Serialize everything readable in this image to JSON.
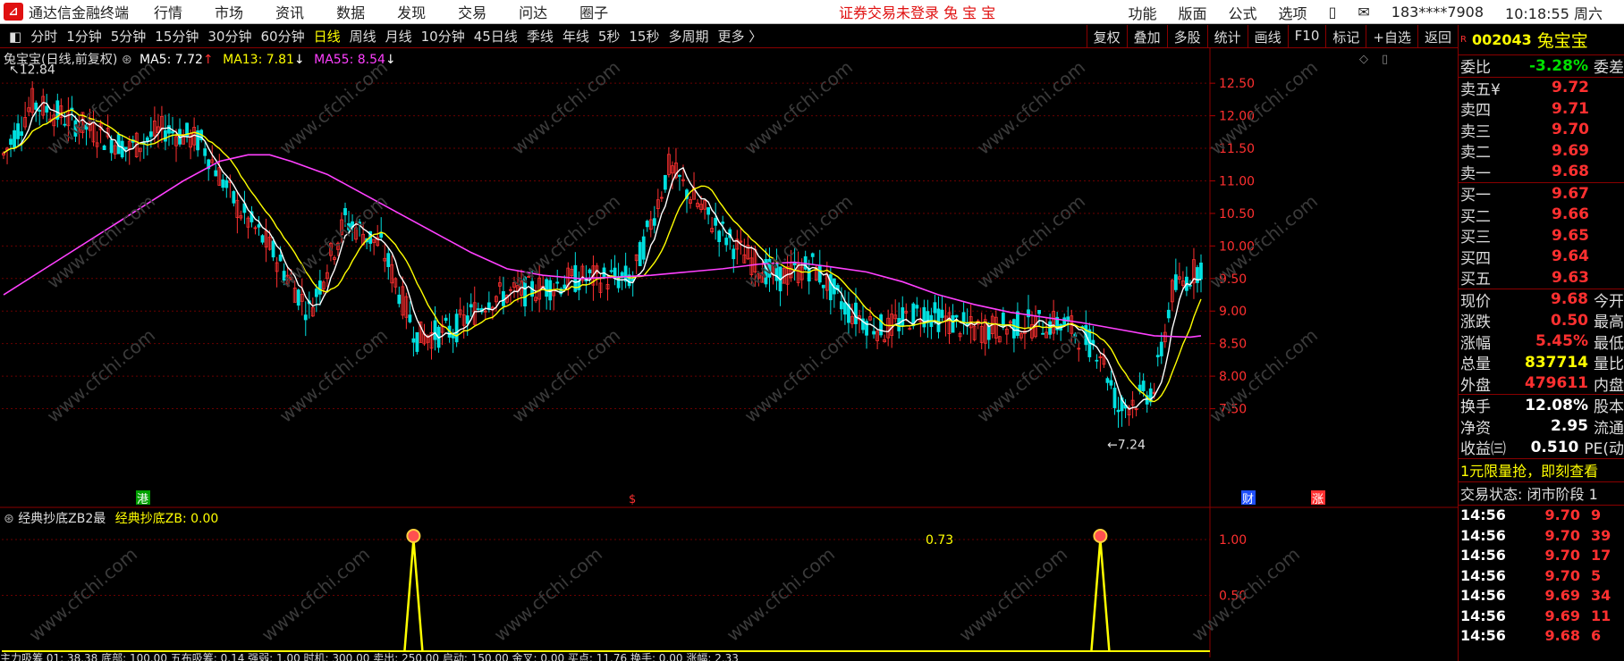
{
  "menubar": {
    "app_name": "通达信金融终端",
    "items": [
      "行情",
      "市场",
      "资讯",
      "数据",
      "发现",
      "交易",
      "问达",
      "圈子"
    ],
    "warning": "证券交易未登录  兔 宝 宝",
    "right_items": [
      "功能",
      "版面",
      "公式",
      "选项"
    ],
    "user": "183****7908",
    "clock": "10:18:55 周六"
  },
  "toolbar": {
    "periods": [
      "分时",
      "1分钟",
      "5分钟",
      "15分钟",
      "30分钟",
      "60分钟",
      "日线",
      "周线",
      "月线",
      "10分钟",
      "45日线",
      "季线",
      "年线",
      "5秒",
      "15秒",
      "多周期",
      "更多 〉"
    ],
    "active": "日线",
    "tools": [
      "复权",
      "叠加",
      "多股",
      "统计",
      "画线",
      "F10",
      "标记",
      "+自选",
      "返回"
    ]
  },
  "main_chart": {
    "title": "兔宝宝(日线,前复权)",
    "ma5": "MA5: 7.72",
    "ma13": "MA13: 7.81",
    "ma55": "MA55: 8.54",
    "high_label": "12.84",
    "low_label": "7.24",
    "markers": [
      "港",
      "$",
      "财",
      "涨"
    ],
    "watermark": "www.cfchi.com"
  },
  "sub_chart": {
    "title": "经典抄底ZB2最",
    "value_label": "经典抄底ZB: 0.00",
    "peak_value": "0.73",
    "yticks": [
      "1.00",
      "0.50"
    ]
  },
  "bottom_strip": "主力吸筹 01: 38.38   底部: 100.00   五布吸筹: 0.14   强弱: 1.00   时机: 300.00   卖出: 250.00   启动: 150.00   金叉: 0.00   买点: 11.76   换手: 0.00   涨幅: 2.33",
  "chart_data": {
    "type": "candlestick",
    "title": "兔宝宝(日线,前复权)",
    "ylim": [
      7.0,
      12.9
    ],
    "yticks": [
      12.5,
      12.0,
      11.5,
      11.0,
      10.5,
      10.0,
      9.5,
      9.0,
      8.5,
      8.0,
      7.5
    ],
    "series_names": [
      "MA5",
      "MA13",
      "MA55"
    ],
    "extremes": {
      "high": 12.84,
      "low": 7.24
    },
    "ma55": [
      [
        0,
        9.25
      ],
      [
        10,
        9.6
      ],
      [
        20,
        9.95
      ],
      [
        30,
        10.3
      ],
      [
        40,
        10.65
      ],
      [
        50,
        11.0
      ],
      [
        60,
        11.3
      ],
      [
        68,
        11.4
      ],
      [
        74,
        11.4
      ],
      [
        80,
        11.3
      ],
      [
        90,
        11.1
      ],
      [
        100,
        10.8
      ],
      [
        110,
        10.5
      ],
      [
        120,
        10.2
      ],
      [
        130,
        9.9
      ],
      [
        140,
        9.65
      ],
      [
        150,
        9.55
      ],
      [
        160,
        9.5
      ],
      [
        170,
        9.52
      ],
      [
        180,
        9.55
      ],
      [
        190,
        9.6
      ],
      [
        200,
        9.65
      ],
      [
        210,
        9.72
      ],
      [
        220,
        9.75
      ],
      [
        230,
        9.68
      ],
      [
        240,
        9.6
      ],
      [
        250,
        9.45
      ],
      [
        260,
        9.25
      ],
      [
        270,
        9.1
      ],
      [
        280,
        8.98
      ],
      [
        290,
        8.9
      ],
      [
        300,
        8.82
      ],
      [
        310,
        8.72
      ],
      [
        320,
        8.62
      ],
      [
        330,
        8.6
      ],
      [
        333,
        8.62
      ]
    ],
    "sub": {
      "ylim": [
        0,
        1.2
      ],
      "peaks": [
        114,
        305
      ],
      "peak_height": 1.0
    }
  },
  "panel": {
    "code": "002043",
    "name": "兔宝宝",
    "weibi": {
      "label": "委比",
      "value": "-3.28%",
      "extra": "委差"
    },
    "sells": [
      {
        "label": "卖五¥",
        "price": "9.72"
      },
      {
        "label": "卖四",
        "price": "9.71"
      },
      {
        "label": "卖三",
        "price": "9.70"
      },
      {
        "label": "卖二",
        "price": "9.69"
      },
      {
        "label": "卖一",
        "price": "9.68"
      }
    ],
    "buys": [
      {
        "label": "买一",
        "price": "9.67"
      },
      {
        "label": "买二",
        "price": "9.66"
      },
      {
        "label": "买三",
        "price": "9.65"
      },
      {
        "label": "买四",
        "price": "9.64"
      },
      {
        "label": "买五",
        "price": "9.63"
      }
    ],
    "stats": [
      {
        "label": "现价",
        "value": "9.68",
        "extra": "今开",
        "cls": "red"
      },
      {
        "label": "涨跌",
        "value": "0.50",
        "extra": "最高",
        "cls": "red"
      },
      {
        "label": "涨幅",
        "value": "5.45%",
        "extra": "最低",
        "cls": "red"
      },
      {
        "label": "总量",
        "value": "837714",
        "extra": "量比",
        "cls": "yellow"
      },
      {
        "label": "外盘",
        "value": "479611",
        "extra": "内盘",
        "cls": "red"
      }
    ],
    "stats2": [
      {
        "label": "换手",
        "value": "12.08%",
        "extra": "股本",
        "cls": "white"
      },
      {
        "label": "净资",
        "value": "2.95",
        "extra": "流通",
        "cls": "white"
      },
      {
        "label": "收益㈢",
        "value": "0.510",
        "extra": "PE(动",
        "cls": "white"
      }
    ],
    "notice": "1元限量抢，即刻查看",
    "state": "交易状态: 闭市阶段 1",
    "ticks": [
      {
        "time": "14:56",
        "price": "9.70",
        "vol": "9"
      },
      {
        "time": "14:56",
        "price": "9.70",
        "vol": "39"
      },
      {
        "time": "14:56",
        "price": "9.70",
        "vol": "17"
      },
      {
        "time": "14:56",
        "price": "9.70",
        "vol": "5"
      },
      {
        "time": "14:56",
        "price": "9.69",
        "vol": "34"
      },
      {
        "time": "14:56",
        "price": "9.69",
        "vol": "11"
      },
      {
        "time": "14:56",
        "price": "9.68",
        "vol": "6"
      }
    ]
  }
}
